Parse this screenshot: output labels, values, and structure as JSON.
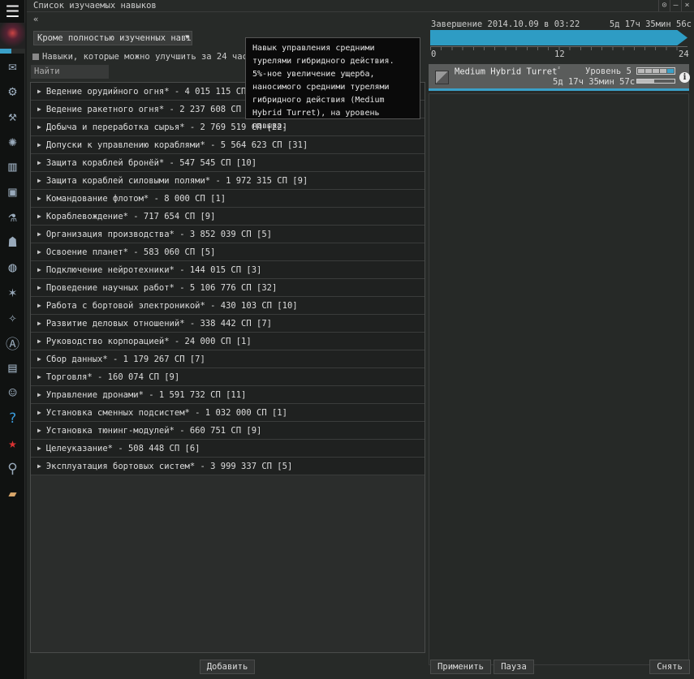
{
  "window": {
    "title": "Список изучаемых навыков",
    "buttons": [
      "⊙",
      "–",
      "×"
    ]
  },
  "left": {
    "collapse": "«",
    "filter": "Кроме полностью изученных навыков",
    "filter_display": "Кроме полностью изученных навı",
    "checkbox_label": "Навыки, которые можно улучшить за 24 часа",
    "search_label": "Найти",
    "groups": [
      "Ведение орудийного огня* - 4 015 115 СП [17]",
      "Ведение ракетного огня* - 2 237 608 СП [15]",
      "Добыча и переработка сырья* - 2 769 519 СП [22]",
      "Допуски к управлению кораблями* - 5 564 623 СП [31]",
      "Защита кораблей бронёй* - 547 545 СП [10]",
      "Защита кораблей силовыми полями* - 1 972 315 СП [9]",
      "Командование флотом* - 8 000 СП [1]",
      "Кораблевождение* - 717 654 СП [9]",
      "Организация производства* - 3 852 039 СП [5]",
      "Освоение планет* - 583 060 СП [5]",
      "Подключение нейротехники* - 144 015 СП [3]",
      "Проведение научных работ* - 5 106 776 СП [32]",
      "Работа с бортовой электроникой* - 430 103 СП [10]",
      "Развитие деловых отношений* - 338 442 СП [7]",
      "Руководство корпорацией* - 24 000 СП [1]",
      "Сбор данных* - 1 179 267 СП [7]",
      "Торговля* - 160 074 СП [9]",
      "Управление дронами* - 1 591 732 СП [11]",
      "Установка сменных подсистем* - 1 032 000 СП [1]",
      "Установка тюнинг-модулей* - 660 751 СП [9]",
      "Целеуказание* - 508 448 СП [6]",
      "Эксплуатация бортовых систем* - 3 999 337 СП [5]"
    ],
    "add_button": "Добавить"
  },
  "right": {
    "completion": "Завершение 2014.10.09 в 03:22",
    "total_time": "5д 17ч 35мин 56с",
    "axis": [
      "0",
      "12",
      "24"
    ],
    "timeline_fill": 1.0,
    "queue": [
      {
        "name": "Medium Hybrid Turret",
        "rank": "²",
        "level": "Уровень 5",
        "time": "5д 17ч 35мин 57с",
        "levels_done": 4,
        "progress": 0.45
      }
    ],
    "apply": "Применить",
    "pause": "Пауза",
    "remove": "Снять"
  },
  "tooltip": "Навык управления средними турелями гибридного действия. 5%-ное увеличение ущерба, наносимого средними турелями гибридного действия (Medium Hybrid Turret), на уровень навыка.",
  "colors": {
    "accent": "#2e9cc4"
  }
}
